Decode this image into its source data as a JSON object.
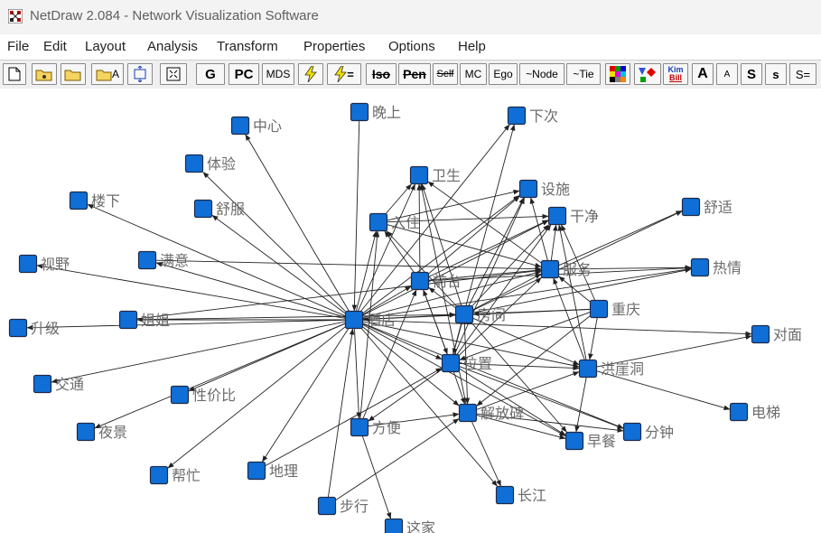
{
  "window": {
    "title": "NetDraw 2.084 - Network Visualization Software"
  },
  "menu": [
    "File",
    "Edit",
    "Layout",
    "Analysis",
    "Transform",
    "Properties",
    "Options",
    "Help"
  ],
  "toolbar": {
    "open_a_suffix": "A",
    "g": "G",
    "pc": "PC",
    "mds": "MDS",
    "eq": "=",
    "iso": "Iso",
    "pen": "Pen",
    "self": "Self",
    "mc": "MC",
    "ego": "Ego",
    "node": "~Node",
    "tie": "~Tie",
    "kim": "Kim",
    "bill": "Bill",
    "a_big": "A",
    "a_small": "A",
    "s_big": "S",
    "s_small": "s",
    "s_eq": "S="
  },
  "colors": {
    "node_fill": "#0f6fd6",
    "node_border": "#1d2a4a",
    "edge": "#222222",
    "label": "#6b6b6b"
  },
  "network": {
    "nodes": [
      {
        "id": "zhongxin",
        "label": "中心"
      },
      {
        "id": "wanshang",
        "label": "晚上"
      },
      {
        "id": "xiaci",
        "label": "下次"
      },
      {
        "id": "tiyan",
        "label": "体验"
      },
      {
        "id": "weisheng",
        "label": "卫生"
      },
      {
        "id": "sheshi",
        "label": "设施"
      },
      {
        "id": "louxia",
        "label": "楼下"
      },
      {
        "id": "shufu",
        "label": "舒服"
      },
      {
        "id": "ruzhu",
        "label": "入住"
      },
      {
        "id": "ganjing",
        "label": "干净"
      },
      {
        "id": "shushi",
        "label": "舒适"
      },
      {
        "id": "shiye",
        "label": "视野"
      },
      {
        "id": "manyi",
        "label": "满意"
      },
      {
        "id": "qiantai",
        "label": "前台"
      },
      {
        "id": "fuwu",
        "label": "服务"
      },
      {
        "id": "reqing",
        "label": "热情"
      },
      {
        "id": "jiejie",
        "label": "姐姐"
      },
      {
        "id": "jiudian",
        "label": "酒店"
      },
      {
        "id": "fangjian",
        "label": "房间"
      },
      {
        "id": "chongqing",
        "label": "重庆"
      },
      {
        "id": "shengji",
        "label": "升级"
      },
      {
        "id": "duimian",
        "label": "对面"
      },
      {
        "id": "weizhi",
        "label": "位置"
      },
      {
        "id": "hongyadong",
        "label": "洪崖洞"
      },
      {
        "id": "jiaotong",
        "label": "交通"
      },
      {
        "id": "xingjiabi",
        "label": "性价比"
      },
      {
        "id": "dianti",
        "label": "电梯"
      },
      {
        "id": "jiefangbei",
        "label": "解放碑"
      },
      {
        "id": "yejing",
        "label": "夜景"
      },
      {
        "id": "fangbian",
        "label": "方便"
      },
      {
        "id": "fenzhong",
        "label": "分钟"
      },
      {
        "id": "zaocan",
        "label": "早餐"
      },
      {
        "id": "bangmang",
        "label": "帮忙"
      },
      {
        "id": "dili",
        "label": "地理"
      },
      {
        "id": "changjiang",
        "label": "长江"
      },
      {
        "id": "buxing",
        "label": "步行"
      },
      {
        "id": "zhejia",
        "label": "这家"
      }
    ],
    "edges": [
      [
        "jiudian",
        "zhongxin"
      ],
      [
        "jiudian",
        "tiyan"
      ],
      [
        "jiudian",
        "louxia"
      ],
      [
        "jiudian",
        "shufu"
      ],
      [
        "jiudian",
        "ruzhu"
      ],
      [
        "jiudian",
        "qiantai"
      ],
      [
        "jiudian",
        "fangjian"
      ],
      [
        "jiudian",
        "fuwu"
      ],
      [
        "jiudian",
        "weisheng"
      ],
      [
        "jiudian",
        "sheshi"
      ],
      [
        "jiudian",
        "ganjing"
      ],
      [
        "jiudian",
        "xiaci"
      ],
      [
        "jiudian",
        "shiye"
      ],
      [
        "jiudian",
        "manyi"
      ],
      [
        "jiudian",
        "shengji"
      ],
      [
        "jiudian",
        "jiejie"
      ],
      [
        "jiudian",
        "jiaotong"
      ],
      [
        "jiudian",
        "yejing"
      ],
      [
        "jiudian",
        "xingjiabi"
      ],
      [
        "jiudian",
        "bangmang"
      ],
      [
        "jiudian",
        "dili"
      ],
      [
        "jiudian",
        "fangbian"
      ],
      [
        "jiudian",
        "weizhi"
      ],
      [
        "jiudian",
        "jiefangbei"
      ],
      [
        "jiudian",
        "hongyadong"
      ],
      [
        "jiudian",
        "zaocan"
      ],
      [
        "jiudian",
        "fenzhong"
      ],
      [
        "jiudian",
        "reqing"
      ],
      [
        "jiudian",
        "duimian"
      ],
      [
        "jiudian",
        "changjiang"
      ],
      [
        "wanshang",
        "jiudian"
      ],
      [
        "buxing",
        "jiudian"
      ],
      [
        "manyi",
        "fuwu"
      ],
      [
        "jiejie",
        "fangjian"
      ],
      [
        "jiejie",
        "fuwu"
      ],
      [
        "fangjian",
        "qiantai"
      ],
      [
        "fangjian",
        "ruzhu"
      ],
      [
        "fangjian",
        "weisheng"
      ],
      [
        "fangjian",
        "sheshi"
      ],
      [
        "fangjian",
        "ganjing"
      ],
      [
        "fangjian",
        "fuwu"
      ],
      [
        "fangjian",
        "hongyadong"
      ],
      [
        "fangjian",
        "weizhi"
      ],
      [
        "fangjian",
        "jiefangbei"
      ],
      [
        "fangjian",
        "reqing"
      ],
      [
        "fangjian",
        "shushi"
      ],
      [
        "qiantai",
        "weisheng"
      ],
      [
        "qiantai",
        "sheshi"
      ],
      [
        "qiantai",
        "ganjing"
      ],
      [
        "qiantai",
        "fuwu"
      ],
      [
        "qiantai",
        "reqing"
      ],
      [
        "qiantai",
        "ruzhu"
      ],
      [
        "ruzhu",
        "weisheng"
      ],
      [
        "ruzhu",
        "sheshi"
      ],
      [
        "ruzhu",
        "ganjing"
      ],
      [
        "ruzhu",
        "fuwu"
      ],
      [
        "fuwu",
        "ganjing"
      ],
      [
        "fuwu",
        "sheshi"
      ],
      [
        "fuwu",
        "reqing"
      ],
      [
        "fuwu",
        "shushi"
      ],
      [
        "fuwu",
        "weisheng"
      ],
      [
        "chongqing",
        "jiudian"
      ],
      [
        "chongqing",
        "fuwu"
      ],
      [
        "chongqing",
        "fangjian"
      ],
      [
        "chongqing",
        "hongyadong"
      ],
      [
        "chongqing",
        "ganjing"
      ],
      [
        "chongqing",
        "weizhi"
      ],
      [
        "chongqing",
        "jiefangbei"
      ],
      [
        "weizhi",
        "hongyadong"
      ],
      [
        "weizhi",
        "jiefangbei"
      ],
      [
        "weizhi",
        "qiantai"
      ],
      [
        "weizhi",
        "fuwu"
      ],
      [
        "weizhi",
        "fenzhong"
      ],
      [
        "weizhi",
        "zaocan"
      ],
      [
        "weizhi",
        "fangbian"
      ],
      [
        "weizhi",
        "sheshi"
      ],
      [
        "weizhi",
        "xiaci"
      ],
      [
        "weizhi",
        "ganjing"
      ],
      [
        "jiefangbei",
        "hongyadong"
      ],
      [
        "jiefangbei",
        "zaocan"
      ],
      [
        "jiefangbei",
        "changjiang"
      ],
      [
        "jiefangbei",
        "fenzhong"
      ],
      [
        "jiefangbei",
        "weisheng"
      ],
      [
        "hongyadong",
        "dianti"
      ],
      [
        "hongyadong",
        "zaocan"
      ],
      [
        "hongyadong",
        "fuwu"
      ],
      [
        "hongyadong",
        "ganjing"
      ],
      [
        "hongyadong",
        "duimian"
      ],
      [
        "fangbian",
        "zhejia"
      ],
      [
        "fangbian",
        "jiefangbei"
      ],
      [
        "fangbian",
        "qiantai"
      ],
      [
        "fangbian",
        "ruzhu"
      ],
      [
        "dili",
        "weizhi"
      ],
      [
        "buxing",
        "jiefangbei"
      ],
      [
        "qiantai",
        "weizhi"
      ],
      [
        "fangjian",
        "zaocan"
      ]
    ]
  }
}
